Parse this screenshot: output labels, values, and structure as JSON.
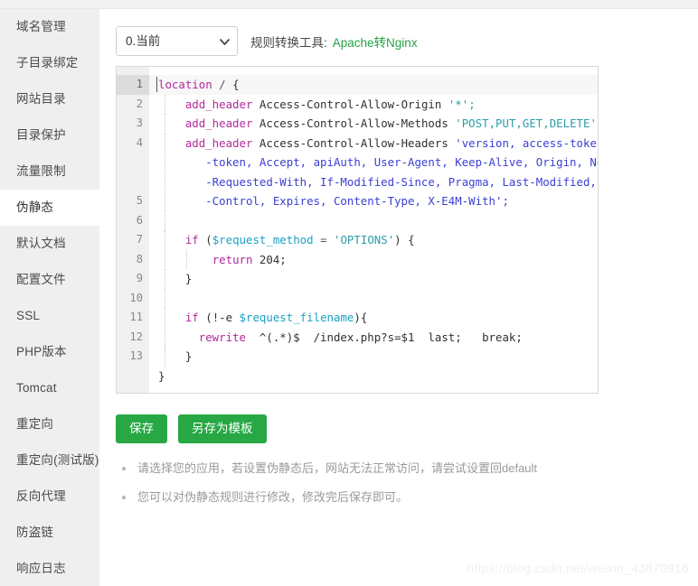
{
  "sidebar": {
    "items": [
      {
        "label": "域名管理",
        "active": false
      },
      {
        "label": "子目录绑定",
        "active": false
      },
      {
        "label": "网站目录",
        "active": false
      },
      {
        "label": "目录保护",
        "active": false
      },
      {
        "label": "流量限制",
        "active": false
      },
      {
        "label": "伪静态",
        "active": true
      },
      {
        "label": "默认文档",
        "active": false
      },
      {
        "label": "配置文件",
        "active": false
      },
      {
        "label": "SSL",
        "active": false
      },
      {
        "label": "PHP版本",
        "active": false
      },
      {
        "label": "Tomcat",
        "active": false
      },
      {
        "label": "重定向",
        "active": false
      },
      {
        "label": "重定向(测试版)",
        "active": false
      },
      {
        "label": "反向代理",
        "active": false
      },
      {
        "label": "防盗链",
        "active": false
      },
      {
        "label": "响应日志",
        "active": false
      }
    ]
  },
  "toolbar": {
    "select_value": "0.当前",
    "select_options": [
      "0.当前"
    ],
    "converter_label": "规则转换工具:",
    "converter_link": "Apache转Nginx",
    "link_color": "#25a244"
  },
  "editor": {
    "line_numbers": [
      "1",
      "2",
      "3",
      "4",
      "5",
      "6",
      "7",
      "8",
      "9",
      "10",
      "11",
      "12",
      "13"
    ],
    "lines": [
      "location / {",
      "    add_header Access-Control-Allow-Origin '*';",
      "    add_header Access-Control-Allow-Methods 'POST,PUT,GET,DELETE';",
      "    add_header Access-Control-Allow-Headers 'version, access-token, user-token, Accept, apiAuth, User-Agent, Keep-Alive, Origin, No-Cache, X-Requested-With, If-Modified-Since, Pragma, Last-Modified, Cache-Control, Expires, Content-Type, X-E4M-With';",
      "",
      "    if ($request_method = 'OPTIONS') {",
      "        return 204;",
      "    }",
      "",
      "    if (!-e $request_filename){",
      "      rewrite  ^(.*)$  /index.php?s=$1  last;   break;",
      "    }",
      "}"
    ],
    "tokens": {
      "line1": {
        "keyword": "location",
        "path": "/",
        "brace": "{"
      },
      "line2": {
        "directive": "add_header",
        "name": "Access-Control-Allow-Origin",
        "value": "'*';"
      },
      "line3": {
        "directive": "add_header",
        "name": "Access-Control-Allow-Methods",
        "value": "'POST,PUT,GET,DELETE';"
      },
      "line4": {
        "directive": "add_header",
        "name": "Access-Control-Allow-Headers",
        "seg1": "'version, access-token, user",
        "seg2": "-token, Accept, apiAuth, User-Agent, Keep-Alive, Origin, No-Cache, X",
        "seg3": "-Requested-With, If-Modified-Since, Pragma, Last-Modified, Cache",
        "seg4": "-Control, Expires, Content-Type, X-E4M-With';"
      },
      "line6": {
        "kw": "if",
        "open": "(",
        "var": "$request_method",
        "op": "=",
        "str": "'OPTIONS'",
        "close": ") {"
      },
      "line7": {
        "kw": "return",
        "num": "204;"
      },
      "line8": {
        "brace": "}"
      },
      "line10": {
        "kw": "if",
        "open": "(!-e ",
        "var": "$request_filename",
        "close": "){"
      },
      "line11": {
        "kw": "rewrite",
        "rest": "  ^(.*)$  /index.php?s=$1  last;   break;"
      },
      "line12": {
        "brace": "}"
      },
      "line13": {
        "brace": "}"
      }
    }
  },
  "buttons": {
    "save": "保存",
    "save_as_template": "另存为模板",
    "color": "#27a844"
  },
  "notes": [
    "请选择您的应用，若设置伪静态后，网站无法正常访问，请尝试设置回default",
    "您可以对伪静态规则进行修改，修改完后保存即可。"
  ],
  "watermark": "https://blog.csdn.net/weixin_43870916"
}
